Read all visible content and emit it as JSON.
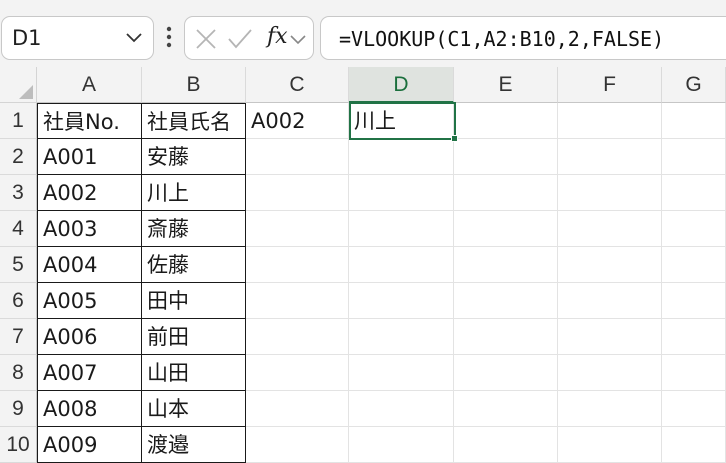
{
  "name_box": {
    "value": "D1"
  },
  "formula_bar": {
    "fx_label": "fx",
    "formula": "=VLOOKUP(C1,A2:B10,2,FALSE)"
  },
  "columns": [
    "A",
    "B",
    "C",
    "D",
    "E",
    "F",
    "G"
  ],
  "selected_column": "D",
  "rows": [
    {
      "num": "1",
      "A": "社員No.",
      "B": "社員氏名",
      "C": "A002",
      "D": "川上"
    },
    {
      "num": "2",
      "A": "A001",
      "B": "安藤"
    },
    {
      "num": "3",
      "A": "A002",
      "B": "川上"
    },
    {
      "num": "4",
      "A": "A003",
      "B": "斎藤"
    },
    {
      "num": "5",
      "A": "A004",
      "B": "佐藤"
    },
    {
      "num": "6",
      "A": "A005",
      "B": "田中"
    },
    {
      "num": "7",
      "A": "A006",
      "B": "前田"
    },
    {
      "num": "8",
      "A": "A007",
      "B": "山田"
    },
    {
      "num": "9",
      "A": "A008",
      "B": "山本"
    },
    {
      "num": "10",
      "A": "A009",
      "B": "渡邉"
    }
  ],
  "colors": {
    "accent": "#217346",
    "header_bg": "#f3f3f3",
    "grid": "#e3e3e3"
  }
}
